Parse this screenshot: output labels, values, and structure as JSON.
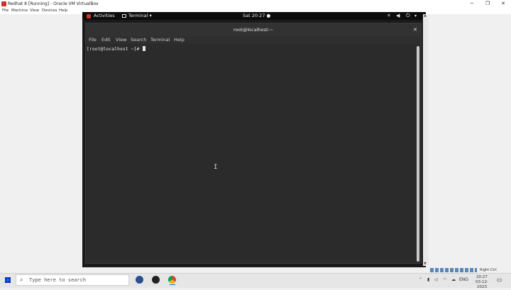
{
  "vbox": {
    "title": "Redhat 8 [Running] - Oracle VM VirtualBox",
    "menu": [
      "File",
      "Machine",
      "View",
      "Devices",
      "Help"
    ],
    "right_ctrl": "Right Ctrl"
  },
  "gnome": {
    "activities": "Activities",
    "app": "Terminal ▾",
    "clock": "Sat 20:27 ●"
  },
  "terminal": {
    "title": "root@localhost:~",
    "menu": [
      "File",
      "Edit",
      "View",
      "Search",
      "Terminal",
      "Help"
    ],
    "prompt": "[root@localhost ~]# "
  },
  "taskbar": {
    "search_placeholder": "Type here to search",
    "lang": "ENG",
    "time": "20:27",
    "date": "03-12-2023"
  },
  "colors": {
    "terminal_bg": "#2b2b2b",
    "gnome_bar": "#0c0c0c",
    "chrome_red": "#db4437"
  }
}
